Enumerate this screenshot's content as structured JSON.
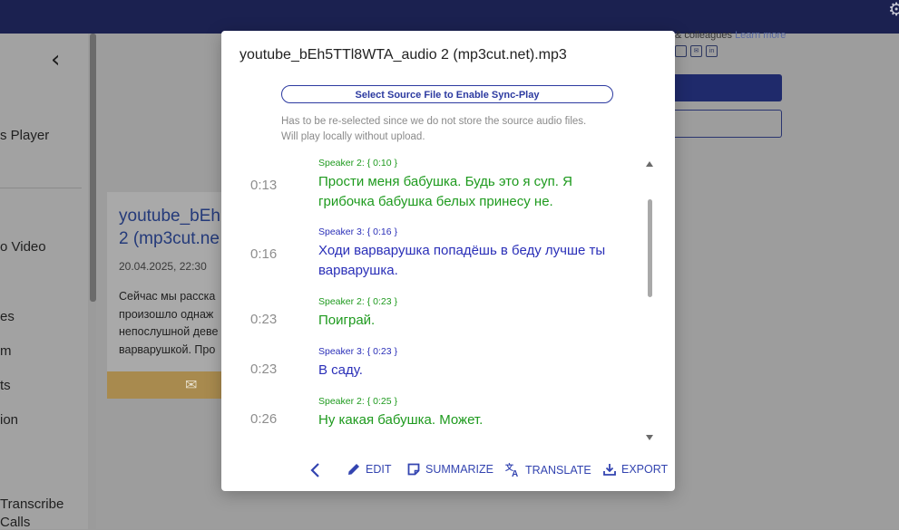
{
  "background": {
    "sidebar": {
      "items": [
        "s Player",
        "o Video",
        "es",
        "m",
        "ts",
        "ion",
        "Transcribe",
        "Calls"
      ]
    },
    "card": {
      "title": [
        "youtube_bEh",
        "2 (mp3cut.ne"
      ],
      "date": "20.04.2025, 22:30",
      "body": [
        "Сейчас мы расска",
        "произошло однаж",
        "непослушной деве",
        "варварушкой. Про"
      ]
    },
    "right": {
      "text": "& colleagues",
      "learn_more": "Learn more"
    }
  },
  "modal": {
    "title": "youtube_bEh5TTl8WTA_audio 2 (mp3cut.net).mp3",
    "sync_button": "Select Source File to Enable Sync-Play",
    "hint_lines": [
      "Has to be re-selected since we do not store the source audio files.",
      "Will play locally without upload."
    ],
    "segments": [
      {
        "time": "0:13",
        "speaker": "Speaker 2:  { 0:10 }",
        "text": "Прости меня бабушка. Будь это я суп. Я грибочка бабушка белых принесу не."
      },
      {
        "time": "0:16",
        "speaker": "Speaker 3:  { 0:16 }",
        "text": "Ходи варварушка попадёшь в беду лучше ты варварушка."
      },
      {
        "time": "0:23",
        "speaker": "Speaker 2:  { 0:23 }",
        "text": "Поиграй."
      },
      {
        "time": "0:23",
        "speaker": "Speaker 3:  { 0:23 }",
        "text": "В саду."
      },
      {
        "time": "0:26",
        "speaker": "Speaker 2:  { 0:25 }",
        "text": "Ну какая бабушка. Может."
      }
    ],
    "actions": {
      "edit": "EDIT",
      "summarize": "SUMMARIZE",
      "translate": "TRANSLATE",
      "export": "EXPORT"
    }
  },
  "colors": {
    "speaker2": "#1e9a1e",
    "speaker3": "#2a2fb8",
    "accent": "#3344b0",
    "topbar": "#1b2150"
  }
}
